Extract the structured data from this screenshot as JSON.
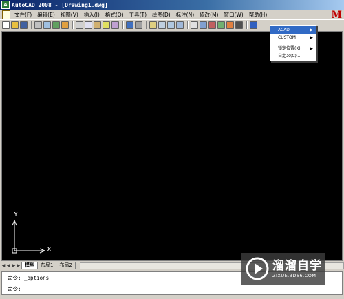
{
  "window": {
    "title": "AutoCAD 2008 - [Drawing1.dwg]",
    "app_icon_text": "A"
  },
  "menubar": {
    "items": [
      "文件(F)",
      "编辑(E)",
      "视图(V)",
      "插入(I)",
      "格式(O)",
      "工具(T)",
      "绘图(D)",
      "标注(N)",
      "修改(M)",
      "窗口(W)",
      "帮助(H)"
    ],
    "brand": "M"
  },
  "toolbar": {
    "buttons": [
      "new-icon",
      "open-icon",
      "save-icon",
      "print-icon",
      "preview-icon",
      "publish-icon",
      "3d-dwf-icon",
      "cut-icon",
      "copy-icon",
      "paste-icon",
      "matchprop-icon",
      "block-editor-icon",
      "undo-icon",
      "redo-icon",
      "pan-icon",
      "zoom-realtime-icon",
      "zoom-window-icon",
      "zoom-previous-icon",
      "properties-icon",
      "design-center-icon",
      "tool-palettes-icon",
      "sheet-set-icon",
      "markup-icon",
      "calculator-icon",
      "help-icon"
    ]
  },
  "context_menu": {
    "items": [
      {
        "label": "ACAD",
        "highlighted": true,
        "submenu": true
      },
      {
        "label": "CUSTOM",
        "highlighted": false,
        "submenu": true
      },
      {
        "label": "锁定位置(K)",
        "highlighted": false,
        "submenu": true
      },
      {
        "label": "自定义(C)...",
        "highlighted": false,
        "submenu": false
      }
    ],
    "arrow": "▶"
  },
  "ucs": {
    "x_label": "X",
    "y_label": "Y"
  },
  "tabs": {
    "nav": [
      "|◀",
      "◀",
      "▶",
      "▶|"
    ],
    "items": [
      "模型",
      "布局1",
      "布局2"
    ],
    "active": "模型"
  },
  "command": {
    "history": "命令: _options",
    "prompt": "命令:"
  },
  "watermark": {
    "name": "溜溜自学",
    "url": "ZIXUE.3D66.COM"
  },
  "colors": {
    "drawing_bg": "#000000",
    "title_start": "#0a246a",
    "highlight": "#316ac5",
    "brand": "#c00000"
  }
}
